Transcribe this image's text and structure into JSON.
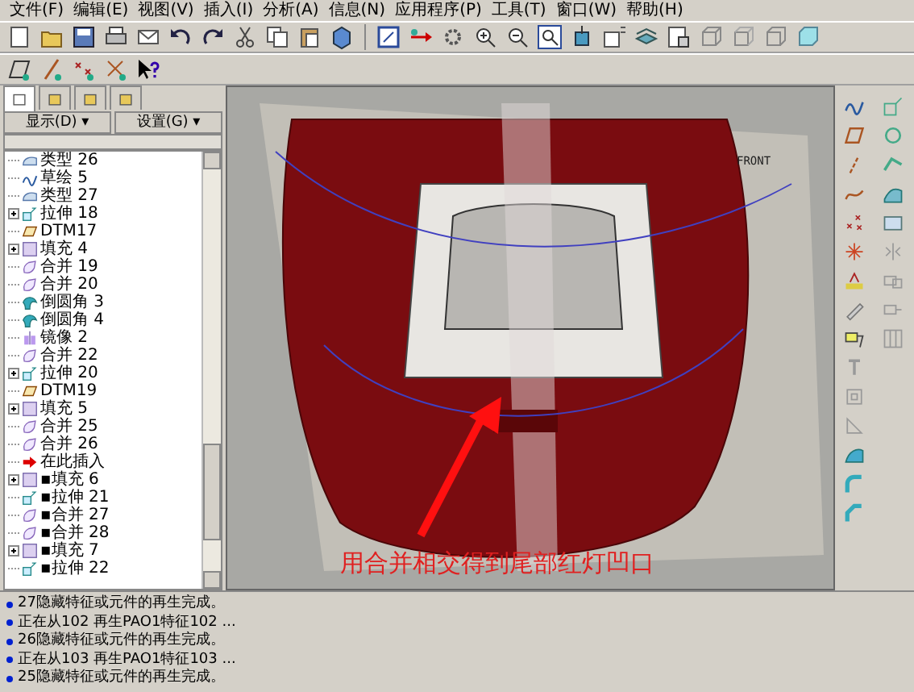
{
  "menu": [
    "文件(F)",
    "编辑(E)",
    "视图(V)",
    "插入(I)",
    "分析(A)",
    "信息(N)",
    "应用程序(P)",
    "工具(T)",
    "窗口(W)",
    "帮助(H)"
  ],
  "panel_tabs": [
    {
      "selected": true
    },
    {
      "selected": false
    },
    {
      "selected": false
    },
    {
      "selected": false
    }
  ],
  "panel_buttons": [
    "显示(D) ▾",
    "设置(G) ▾"
  ],
  "model_tree": [
    {
      "label": "类型 26",
      "kind": "quilt",
      "expandable": false
    },
    {
      "label": "草绘 5",
      "kind": "sketch",
      "expandable": false
    },
    {
      "label": "类型 27",
      "kind": "quilt",
      "expandable": false
    },
    {
      "label": "拉伸 18",
      "kind": "extrude",
      "expandable": true
    },
    {
      "label": "DTM17",
      "kind": "datum",
      "expandable": false
    },
    {
      "label": "填充 4",
      "kind": "fill",
      "expandable": true
    },
    {
      "label": "合并 19",
      "kind": "merge",
      "expandable": false
    },
    {
      "label": "合并 20",
      "kind": "merge",
      "expandable": false
    },
    {
      "label": "倒圆角 3",
      "kind": "round",
      "expandable": false
    },
    {
      "label": "倒圆角 4",
      "kind": "round",
      "expandable": false
    },
    {
      "label": "镜像 2",
      "kind": "mirror",
      "expandable": false
    },
    {
      "label": "合并 22",
      "kind": "merge",
      "expandable": false
    },
    {
      "label": "拉伸 20",
      "kind": "extrude",
      "expandable": true
    },
    {
      "label": "DTM19",
      "kind": "datum",
      "expandable": false
    },
    {
      "label": "填充 5",
      "kind": "fill",
      "expandable": true
    },
    {
      "label": "合并 25",
      "kind": "merge",
      "expandable": false
    },
    {
      "label": "合并 26",
      "kind": "merge",
      "expandable": false
    },
    {
      "label": "在此插入",
      "kind": "insert",
      "expandable": false
    },
    {
      "label": "▪填充 6",
      "kind": "fill",
      "expandable": true
    },
    {
      "label": "▪拉伸 21",
      "kind": "extrude",
      "expandable": false
    },
    {
      "label": "▪合并 27",
      "kind": "merge",
      "expandable": false
    },
    {
      "label": "▪合并 28",
      "kind": "merge",
      "expandable": false
    },
    {
      "label": "▪填充 7",
      "kind": "fill",
      "expandable": true
    },
    {
      "label": "▪拉伸 22",
      "kind": "extrude",
      "expandable": false
    }
  ],
  "viewport": {
    "datum_label": "FRONT",
    "annotation": "用合并相交得到尾部红灯凹口"
  },
  "messages": [
    "27隐藏特征或元件的再生完成。",
    "正在从102 再生PAO1特征102 ...",
    "26隐藏特征或元件的再生完成。",
    "正在从103 再生PAO1特征103 ...",
    "25隐藏特征或元件的再生完成。"
  ]
}
